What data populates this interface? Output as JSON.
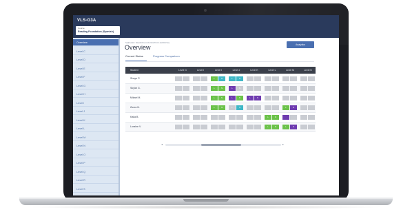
{
  "app": {
    "title": "VLS-G3A"
  },
  "course": {
    "small_label": "Course",
    "name": "Reading Foundation (Spanish)"
  },
  "sidebar": {
    "items": [
      {
        "label": "Overview",
        "active": true
      },
      {
        "label": "Level C"
      },
      {
        "label": "Level D"
      },
      {
        "label": "Level E"
      },
      {
        "label": "Level F"
      },
      {
        "label": "Level G"
      },
      {
        "label": "Level H"
      },
      {
        "label": "Level I"
      },
      {
        "label": "Level J"
      },
      {
        "label": "Level K"
      },
      {
        "label": "Level L"
      },
      {
        "label": "Level M"
      },
      {
        "label": "Level N"
      },
      {
        "label": "Level O"
      },
      {
        "label": "Level P"
      },
      {
        "label": "Level Q"
      },
      {
        "label": "Level R"
      },
      {
        "label": "Level S"
      }
    ]
  },
  "main": {
    "breadcrumb": "SEESAW / READING FOUNDATION (SPANISH)",
    "title": "Overview",
    "analytics_button": "Analytics",
    "tabs": [
      {
        "label": "Current Status",
        "active": true
      },
      {
        "label": "Progress Comparison",
        "active": false
      }
    ]
  },
  "grid": {
    "student_header": "Student",
    "levels": [
      "Level G",
      "Level I",
      "Level I",
      "Level J",
      "Level K",
      "Level L",
      "Level M",
      "Level N"
    ],
    "rows": [
      {
        "name": "Shaye P.",
        "cells": [
          [
            "",
            ""
          ],
          [
            "",
            ""
          ],
          [
            "L",
            "N"
          ],
          [
            "L",
            "N"
          ],
          [
            "",
            ""
          ],
          [
            "",
            ""
          ],
          [
            "",
            ""
          ],
          [
            "",
            ""
          ]
        ],
        "colors": [
          [
            "g",
            "g"
          ],
          [
            "g",
            "g"
          ],
          [
            "green",
            "teal"
          ],
          [
            "teal",
            "teal"
          ],
          [
            "g",
            "g"
          ],
          [
            "g",
            "g"
          ],
          [
            "g",
            "g"
          ],
          [
            "g",
            "g"
          ]
        ]
      },
      {
        "name": "Skylar G.",
        "cells": [
          [
            "",
            ""
          ],
          [
            "",
            ""
          ],
          [
            "L",
            "N"
          ],
          [
            "L",
            "N"
          ],
          [
            "",
            ""
          ],
          [
            "",
            ""
          ],
          [
            "",
            ""
          ],
          [
            "",
            ""
          ]
        ],
        "colors": [
          [
            "g",
            "g"
          ],
          [
            "g",
            "g"
          ],
          [
            "green",
            "green"
          ],
          [
            "purple",
            "g"
          ],
          [
            "g",
            "g"
          ],
          [
            "g",
            "g"
          ],
          [
            "g",
            "g"
          ],
          [
            "g",
            "g"
          ]
        ]
      },
      {
        "name": "Mikael M.",
        "cells": [
          [
            "",
            ""
          ],
          [
            "",
            ""
          ],
          [
            "L",
            "N"
          ],
          [
            "L",
            "N"
          ],
          [
            "L",
            "N"
          ],
          [
            "",
            ""
          ],
          [
            "",
            ""
          ],
          [
            "",
            ""
          ]
        ],
        "colors": [
          [
            "g",
            "g"
          ],
          [
            "g",
            "g"
          ],
          [
            "green",
            "green"
          ],
          [
            "purple",
            "green"
          ],
          [
            "purple",
            "purple"
          ],
          [
            "g",
            "g"
          ],
          [
            "g",
            "g"
          ],
          [
            "g",
            "g"
          ]
        ]
      },
      {
        "name": "Zuora N.",
        "cells": [
          [
            "",
            ""
          ],
          [
            "",
            ""
          ],
          [
            "L",
            "N"
          ],
          [
            "L",
            "N"
          ],
          [
            "",
            ""
          ],
          [
            "",
            ""
          ],
          [
            "L",
            "N"
          ],
          [
            "",
            ""
          ]
        ],
        "colors": [
          [
            "g",
            "g"
          ],
          [
            "g",
            "g"
          ],
          [
            "green",
            "green"
          ],
          [
            "g",
            "teal"
          ],
          [
            "g",
            "g"
          ],
          [
            "g",
            "g"
          ],
          [
            "green",
            "purple"
          ],
          [
            "g",
            "g"
          ]
        ]
      },
      {
        "name": "Kaila B.",
        "cells": [
          [
            "",
            ""
          ],
          [
            "",
            ""
          ],
          [
            "",
            ""
          ],
          [
            "",
            ""
          ],
          [
            "",
            ""
          ],
          [
            "L",
            "N"
          ],
          [
            "",
            ""
          ],
          [
            "",
            ""
          ]
        ],
        "colors": [
          [
            "g",
            "g"
          ],
          [
            "g",
            "g"
          ],
          [
            "g",
            "g"
          ],
          [
            "g",
            "g"
          ],
          [
            "g",
            "g"
          ],
          [
            "green",
            "green"
          ],
          [
            "purple",
            "g"
          ],
          [
            "g",
            "g"
          ]
        ]
      },
      {
        "name": "Loraine V.",
        "cells": [
          [
            "",
            ""
          ],
          [
            "",
            ""
          ],
          [
            "",
            ""
          ],
          [
            "",
            ""
          ],
          [
            "",
            ""
          ],
          [
            "L",
            "N"
          ],
          [
            "L",
            "N"
          ],
          [
            "",
            ""
          ]
        ],
        "colors": [
          [
            "g",
            "g"
          ],
          [
            "g",
            "g"
          ],
          [
            "g",
            "g"
          ],
          [
            "g",
            "g"
          ],
          [
            "g",
            "g"
          ],
          [
            "green",
            "green"
          ],
          [
            "green",
            "purple"
          ],
          [
            "g",
            "g"
          ]
        ]
      }
    ]
  },
  "colors": {
    "green": "#6bc24a",
    "teal": "#3fb7c6",
    "purple": "#6e3bb0",
    "g": "#c9ccd2",
    "header": "#2a3a5c",
    "accent": "#4a6fb0"
  }
}
